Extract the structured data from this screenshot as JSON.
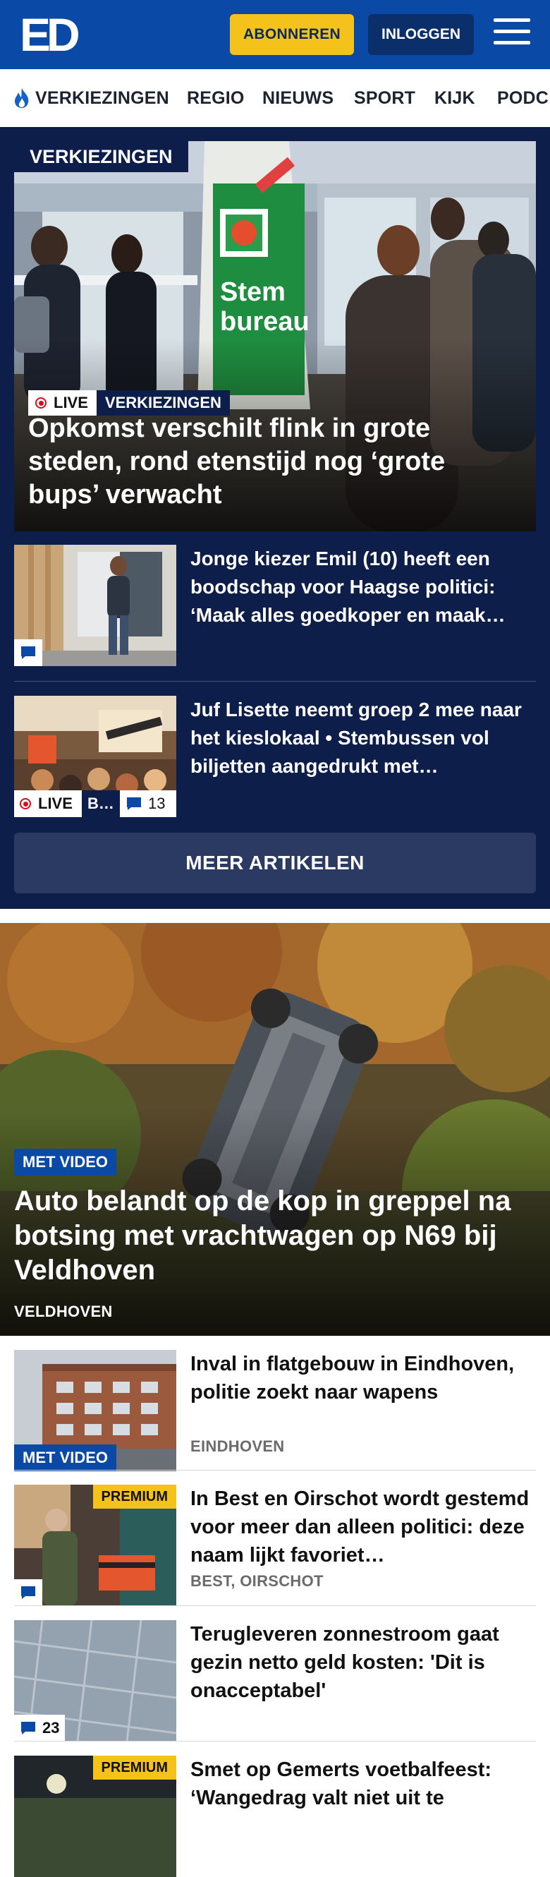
{
  "header": {
    "logo_text": "ED",
    "subscribe_label": "ABONNEREN",
    "login_label": "INLOGGEN"
  },
  "nav": {
    "items": [
      {
        "label": "VERKIEZINGEN",
        "icon": "flame-icon"
      },
      {
        "label": "REGIO"
      },
      {
        "label": "NIEUWS"
      },
      {
        "label": "SPORT"
      },
      {
        "label": "KIJK"
      },
      {
        "label": "PODC"
      }
    ]
  },
  "elections": {
    "section_label": "VERKIEZINGEN",
    "hero": {
      "live_label": "LIVE",
      "category_label": "VERKIEZINGEN",
      "title": "Opkomst verschilt flink in grote steden, rond etenstijd nog ‘grote bups’ verwacht",
      "image_text_1": "Stem",
      "image_text_2": "bureau"
    },
    "articles": [
      {
        "title": "Jonge kiezer Emil (10) heeft een boodschap voor Haagse politici: ‘Maak alles goedkoper en maak…",
        "comment_icon": "comment-icon"
      },
      {
        "title": "Juf Lisette neemt groep 2 mee naar het kieslokaal • Stembussen vol biljetten aangedrukt met…",
        "live_label": "LIVE",
        "category_short": "B…",
        "comment_count": "13"
      }
    ],
    "more_label": "MEER ARTIKELEN"
  },
  "feature": {
    "badge": "MET VIDEO",
    "title": "Auto belandt op de kop in greppel na botsing met vrachtwagen op N69 bij Veldhoven",
    "location": "VELDHOVEN"
  },
  "list": [
    {
      "title": "Inval in flatgebouw in Eindhoven, politie zoekt naar wapens",
      "location": "EINDHOVEN",
      "badge": "MET VIDEO"
    },
    {
      "title": "In Best en Oirschot wordt gestemd voor meer dan alleen politici: deze naam lijkt favoriet…",
      "location": "BEST, OIRSCHOT",
      "premium": "PREMIUM"
    },
    {
      "title": "Terugleveren zonnestroom gaat gezin netto geld kosten: 'Dit is onacceptabel'",
      "comment_count": "23"
    },
    {
      "title": "Smet op Gemerts voetbalfeest: ‘Wangedrag valt niet uit te",
      "premium": "PREMIUM"
    }
  ]
}
